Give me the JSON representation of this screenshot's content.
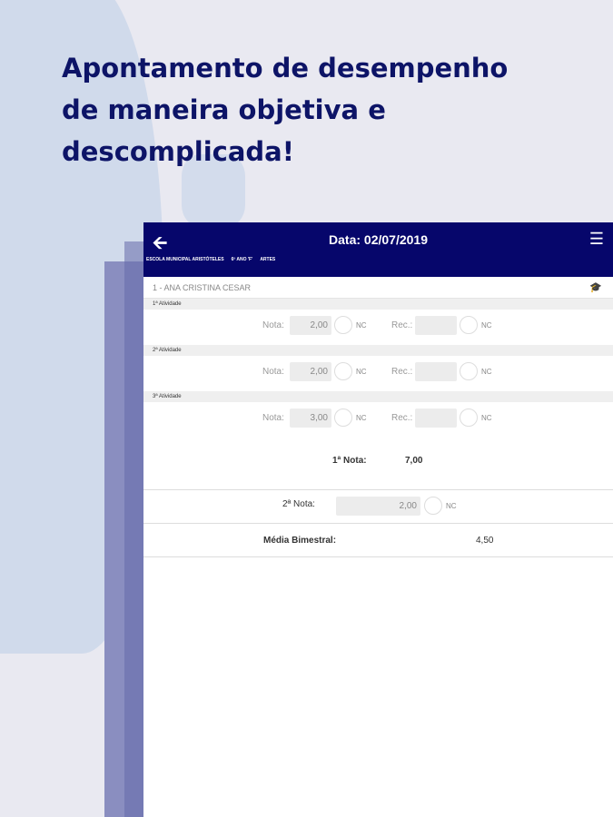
{
  "headline": [
    "Apontamento de desempenho",
    "de maneira objetiva e",
    "descomplicada!"
  ],
  "header": {
    "title": "Data: 02/07/2019",
    "crumbs": [
      "ESCOLA MUNICIPAL ARISTÓTELES",
      "6º ANO 'F'",
      "ARTES"
    ]
  },
  "student": "1 - ANA CRISTINA CESAR",
  "activities": [
    {
      "label": "1ª Atividade",
      "nota_label": "Nota:",
      "nota": "2,00",
      "nc": "NC",
      "rec_label": "Rec.:",
      "rec": ""
    },
    {
      "label": "2ª Atividade",
      "nota_label": "Nota:",
      "nota": "2,00",
      "nc": "NC",
      "rec_label": "Rec.:",
      "rec": ""
    },
    {
      "label": "3ª Atividade",
      "nota_label": "Nota:",
      "nota": "3,00",
      "nc": "NC",
      "rec_label": "Rec.:",
      "rec": ""
    }
  ],
  "summary": {
    "nota1_label": "1ª Nota:",
    "nota1": "7,00",
    "nota2_label": "2ª Nota:",
    "nota2": "2,00",
    "nc": "NC",
    "media_label": "Média Bimestral:",
    "media": "4,50"
  }
}
